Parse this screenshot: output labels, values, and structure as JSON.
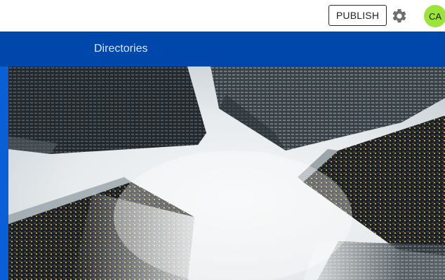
{
  "header": {
    "publish_label": "PUBLISH",
    "settings_icon": "gear-icon",
    "avatar_initials": "CA",
    "avatar_color": "#9be53a"
  },
  "nav": {
    "items": [
      {
        "label": "Directories"
      }
    ],
    "bar_color": "#0047ab"
  },
  "hero": {
    "image": "skyscrapers-looking-up-into-fog"
  },
  "colors": {
    "accent_strip": "#0a5fd8"
  }
}
